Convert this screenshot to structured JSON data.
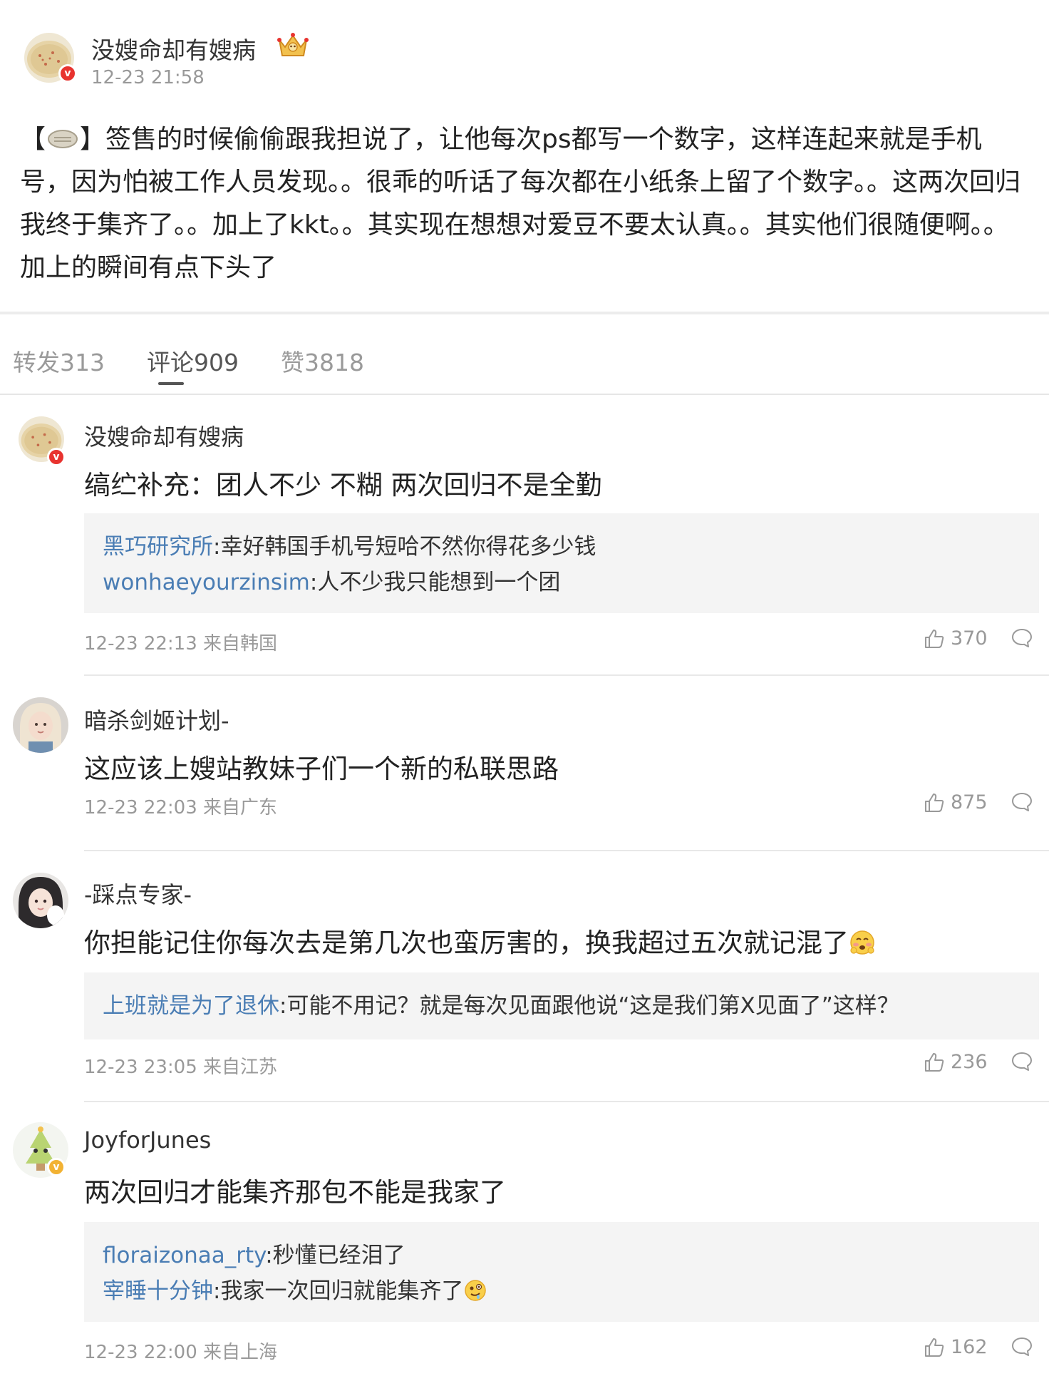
{
  "post": {
    "author": "没嫂命却有嫂病",
    "time": "12-23 21:58",
    "text_open": "【",
    "text_body": "】签售的时候偷偷跟我担说了，让他每次ps都写一个数字，这样连起来就是手机号，因为怕被工作人员发现。。很乖的听话了每次都在小纸条上留了个数字。。这两次回归我终于集齐了。。加上了kkt。。其实现在想想对爱豆不要太认真。。其实他们很随便啊。。加上的瞬间有点下头了"
  },
  "tabs": [
    {
      "label": "转发313"
    },
    {
      "label": "评论909"
    },
    {
      "label": "赞3818"
    }
  ],
  "comments": [
    {
      "author": "没嫂命却有嫂病",
      "text": "缟纻补充：团人不少 不糊 两次回归不是全勤",
      "replies": [
        {
          "user": "黑巧研究所",
          "text": ":幸好韩国手机号短哈不然你得花多少钱"
        },
        {
          "user": "wonhaeyourzinsim",
          "text": ":人不少我只能想到一个团"
        }
      ],
      "meta": "12-23 22:13 来自韩国",
      "likes": "370"
    },
    {
      "author": "暗杀剑姬计划-",
      "text": "这应该上嫂站教妹子们一个新的私联思路",
      "meta": "12-23 22:03 来自广东",
      "likes": "875"
    },
    {
      "author": "-踩点专家-",
      "text": "你担能记住你每次去是第几次也蛮厉害的，换我超过五次就记混了",
      "replies": [
        {
          "user": "上班就是为了退休",
          "text": ":可能不用记？就是每次见面跟他说“这是我们第X见面了”这样？"
        }
      ],
      "meta": "12-23 23:05 来自江苏",
      "likes": "236"
    },
    {
      "author": "JoyforJunes",
      "text": "两次回归才能集齐那包不能是我家了",
      "replies": [
        {
          "user": "floraizonaa_rty",
          "text": ":秒懂已经泪了"
        },
        {
          "user": "宰睡十分钟",
          "text": ":我家一次回归就能集齐了"
        }
      ],
      "meta": "12-23 22:00 来自上海",
      "likes": "162"
    }
  ],
  "colors": {
    "link": "#4a7db4",
    "meta": "#999999",
    "badge_red": "#e8332f",
    "badge_gold": "#f2b233"
  }
}
